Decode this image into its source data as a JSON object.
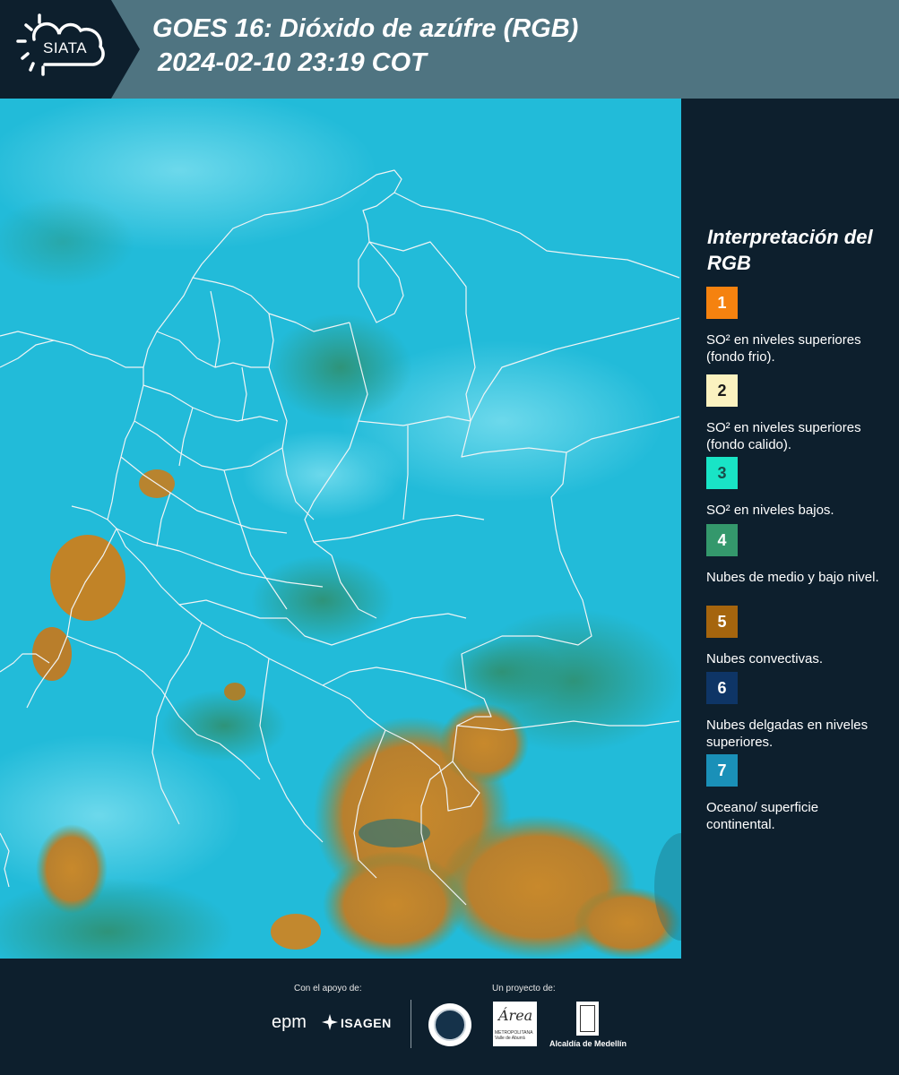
{
  "header": {
    "logo_label": "SIATA",
    "title_line_1": "GOES 16: Dióxido de azúfre (RGB)",
    "title_line_2": "2024-02-10 23:19 COT"
  },
  "colors": {
    "header_bg": "#4f7481",
    "page_bg": "#0d1f2d",
    "map_cyan": "#1fb9d9",
    "map_convective": "#c2852b",
    "map_green": "#3c9f78",
    "border_line": "#f0f4f5"
  },
  "legend": {
    "title": "Interpretación del RGB",
    "items": [
      {
        "number": "1",
        "color": "#f5820f",
        "label": "SO² en niveles superiores (fondo frio)."
      },
      {
        "number": "2",
        "color": "#fbf2c0",
        "label": "SO² en niveles superiores (fondo calido)."
      },
      {
        "number": "3",
        "color": "#19e4c6",
        "label": "SO² en niveles bajos."
      },
      {
        "number": "4",
        "color": "#34986c",
        "label": "Nubes de medio y bajo nivel."
      },
      {
        "number": "5",
        "color": "#a5650e",
        "label": "Nubes convectivas."
      },
      {
        "number": "6",
        "color": "#0e3566",
        "label": "Nubes delgadas en niveles superiores."
      },
      {
        "number": "7",
        "color": "#1a90b8",
        "label": "Oceano/ superficie continental."
      }
    ]
  },
  "footer": {
    "support_caption": "Con el apoyo de:",
    "project_caption": "Un proyecto de:",
    "sponsor_1": "epm",
    "sponsor_2": "ISAGEN",
    "area_logo": "Área",
    "area_logo_sub": "METROPOLITANA Valle de Aburrá",
    "alcaldia": "Alcaldía de Medellín"
  },
  "icons": {
    "logo": "siata-sun-cloud-icon",
    "isagen": "isagen-star-icon",
    "seal": "university-seal-icon",
    "emblem": "medellin-coat-of-arms-icon"
  }
}
